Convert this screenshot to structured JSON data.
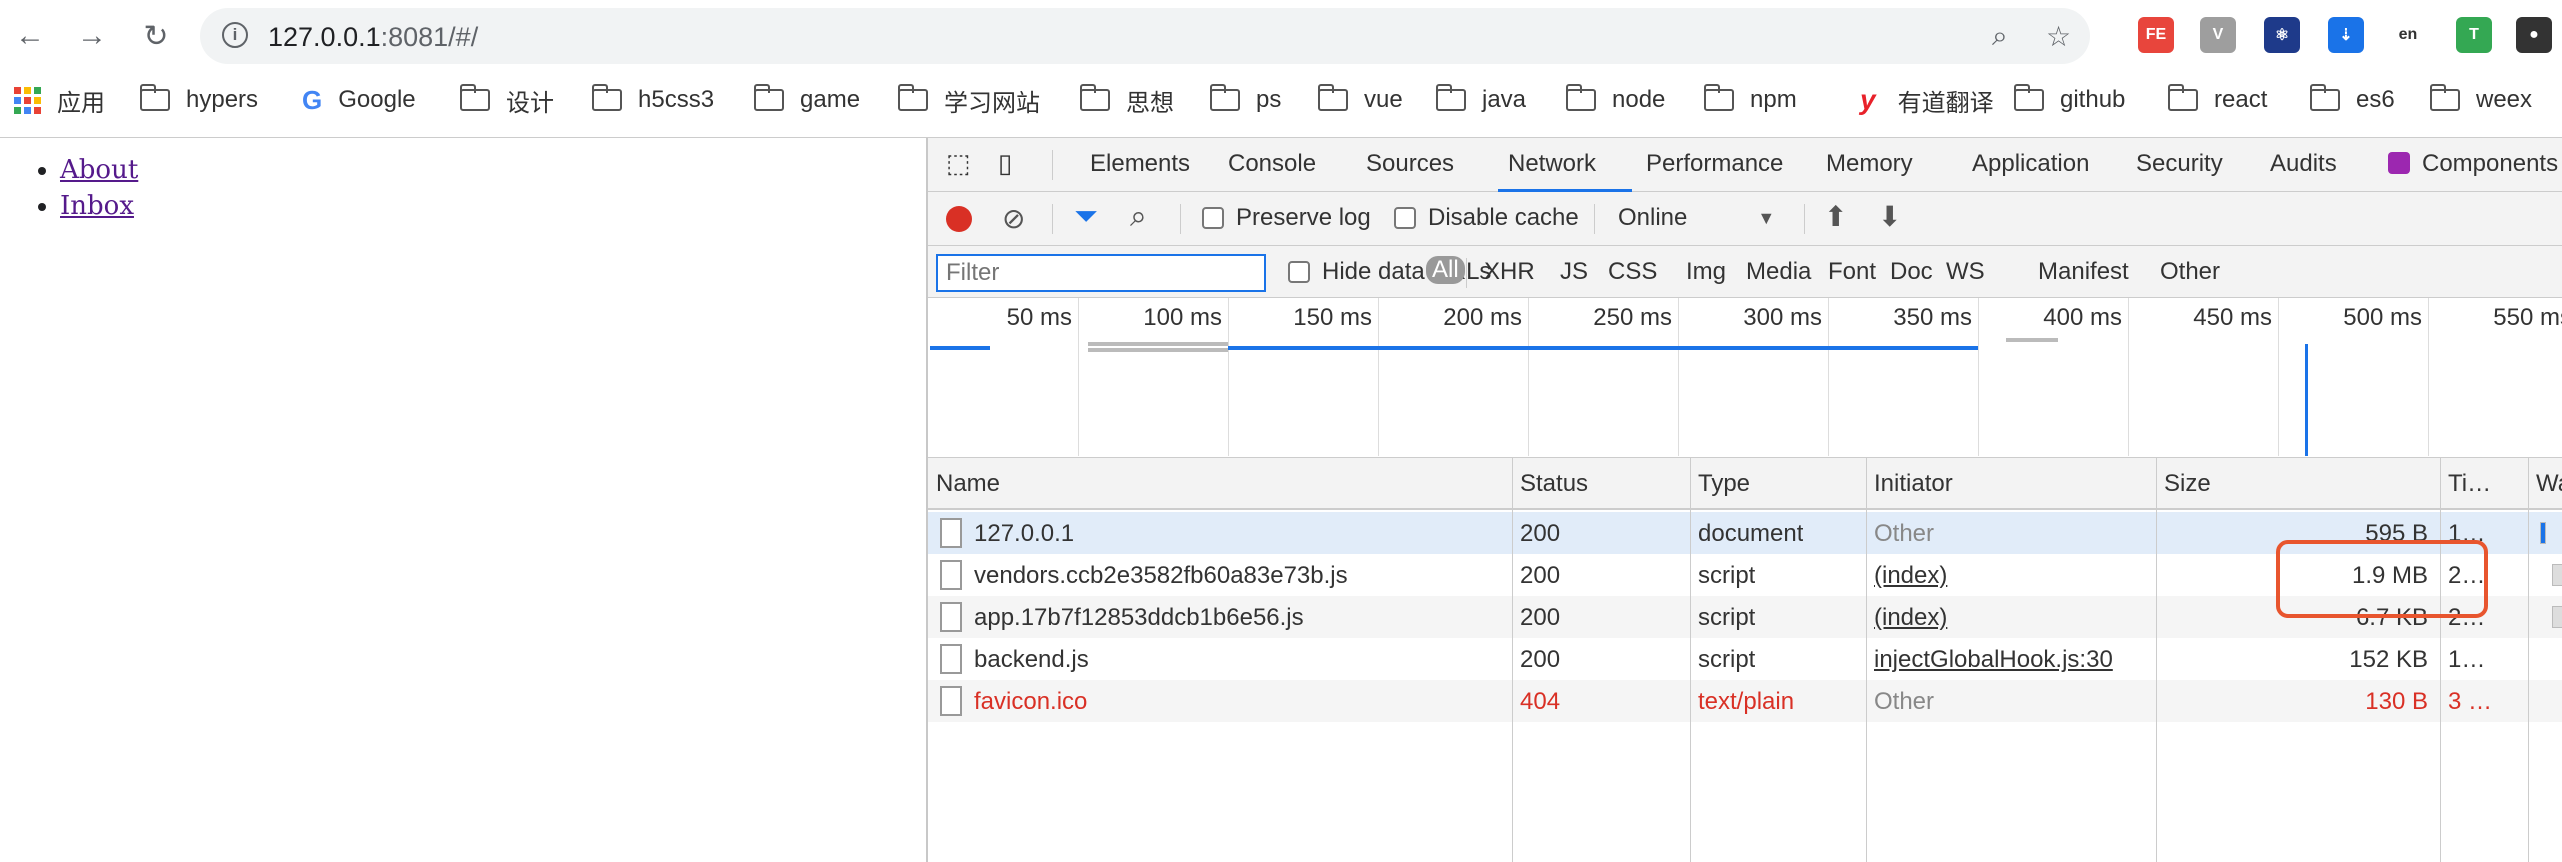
{
  "browser": {
    "url_host": "127.0.0.1",
    "url_rest": ":8081/#/",
    "extensions": [
      {
        "name": "fe-helper",
        "label": "FE",
        "color": "#e8453c"
      },
      {
        "name": "vue-devtools",
        "label": "V",
        "color": "#9e9e9e"
      },
      {
        "name": "react-devtools",
        "label": "⚛",
        "color": "#1e3a8a"
      },
      {
        "name": "download-ext",
        "label": "⇣",
        "color": "#1a73e8"
      },
      {
        "name": "translate-ext",
        "label": "en",
        "color": "#ffffff"
      },
      {
        "name": "tampermonkey-ext",
        "label": "T",
        "color": "#34a853"
      },
      {
        "name": "ghost-ext",
        "label": "●",
        "color": "#333333"
      }
    ]
  },
  "bookmarks": [
    {
      "label": "应用",
      "type": "apps"
    },
    {
      "label": "hypers",
      "type": "folder"
    },
    {
      "label": "Google",
      "type": "google"
    },
    {
      "label": "设计",
      "type": "folder"
    },
    {
      "label": "h5css3",
      "type": "folder"
    },
    {
      "label": "game",
      "type": "folder"
    },
    {
      "label": "学习网站",
      "type": "folder"
    },
    {
      "label": "思想",
      "type": "folder"
    },
    {
      "label": "ps",
      "type": "folder"
    },
    {
      "label": "vue",
      "type": "folder"
    },
    {
      "label": "java",
      "type": "folder"
    },
    {
      "label": "node",
      "type": "folder"
    },
    {
      "label": "npm",
      "type": "folder"
    },
    {
      "label": "有道翻译",
      "type": "youdao"
    },
    {
      "label": "github",
      "type": "folder"
    },
    {
      "label": "react",
      "type": "folder"
    },
    {
      "label": "es6",
      "type": "folder"
    },
    {
      "label": "weex",
      "type": "folder"
    }
  ],
  "page": {
    "links": [
      "About",
      "Inbox"
    ]
  },
  "devtools": {
    "tabs": [
      "Elements",
      "Console",
      "Sources",
      "Network",
      "Performance",
      "Memory",
      "Application",
      "Security",
      "Audits",
      "Components"
    ],
    "active_tab": "Network",
    "toolbar": {
      "preserve_log": "Preserve log",
      "disable_cache": "Disable cache",
      "throttle": "Online"
    },
    "filter": {
      "placeholder": "Filter",
      "hide_data_urls": "Hide data URLs",
      "types": [
        "All",
        "XHR",
        "JS",
        "CSS",
        "Img",
        "Media",
        "Font",
        "Doc",
        "WS",
        "Manifest",
        "Other"
      ]
    },
    "timeline_ticks": [
      "50 ms",
      "100 ms",
      "150 ms",
      "200 ms",
      "250 ms",
      "300 ms",
      "350 ms",
      "400 ms",
      "450 ms",
      "500 ms",
      "550 ms"
    ],
    "columns": [
      "Name",
      "Status",
      "Type",
      "Initiator",
      "Size",
      "Ti…",
      "Wate"
    ],
    "rows": [
      {
        "name": "127.0.0.1",
        "status": "200",
        "type": "document",
        "initiator": "Other",
        "initiator_link": false,
        "size": "595 B",
        "time": "1…",
        "error": false,
        "selected": true
      },
      {
        "name": "vendors.ccb2e3582fb60a83e73b.js",
        "status": "200",
        "type": "script",
        "initiator": "(index)",
        "initiator_link": true,
        "size": "1.9 MB",
        "time": "2…",
        "error": false,
        "selected": false
      },
      {
        "name": "app.17b7f12853ddcb1b6e56.js",
        "status": "200",
        "type": "script",
        "initiator": "(index)",
        "initiator_link": true,
        "size": "6.7 KB",
        "time": "2…",
        "error": false,
        "selected": false
      },
      {
        "name": "backend.js",
        "status": "200",
        "type": "script",
        "initiator": "injectGlobalHook.js:30",
        "initiator_link": true,
        "size": "152 KB",
        "time": "1…",
        "error": false,
        "selected": false
      },
      {
        "name": "favicon.ico",
        "status": "404",
        "type": "text/plain",
        "initiator": "Other",
        "initiator_link": false,
        "size": "130 B",
        "time": "3 …",
        "error": true,
        "selected": false
      }
    ]
  },
  "colors": {
    "error": "#d93025",
    "selected_row": "#e1ecf9",
    "highlight": "#e8552e",
    "accent": "#1a73e8"
  }
}
